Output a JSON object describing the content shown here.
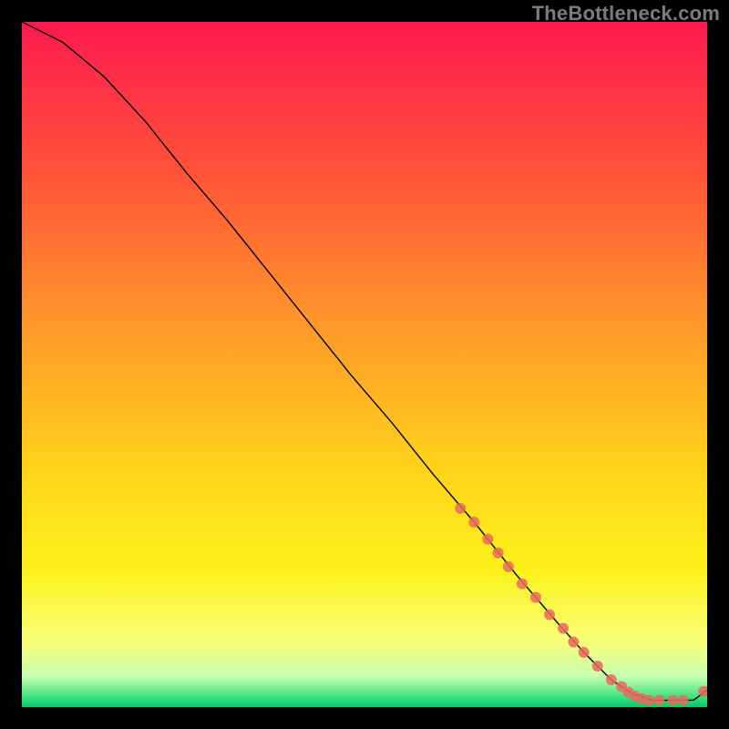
{
  "watermark": "TheBottleneck.com",
  "chart_data": {
    "type": "line",
    "title": "",
    "xlabel": "",
    "ylabel": "",
    "xlim": [
      0,
      100
    ],
    "ylim": [
      0,
      100
    ],
    "grid": false,
    "legend": false,
    "gradient_stops": [
      {
        "pos": 0.0,
        "color": "#ff1a4f"
      },
      {
        "pos": 0.2,
        "color": "#ff4d3a"
      },
      {
        "pos": 0.45,
        "color": "#ff9a2a"
      },
      {
        "pos": 0.65,
        "color": "#ffd21a"
      },
      {
        "pos": 0.8,
        "color": "#fdf11a"
      },
      {
        "pos": 0.905,
        "color": "#f7ff7a"
      },
      {
        "pos": 0.955,
        "color": "#c8ffb0"
      },
      {
        "pos": 0.985,
        "color": "#40e080"
      },
      {
        "pos": 1.0,
        "color": "#00c868"
      }
    ],
    "series": [
      {
        "name": "bottleneck-curve",
        "color": "#000000",
        "width": 1.4,
        "x": [
          0,
          6,
          12,
          18,
          24,
          30,
          36,
          42,
          48,
          54,
          60,
          66,
          72,
          78,
          82,
          86,
          89,
          92,
          95,
          98,
          100
        ],
        "y": [
          100,
          97,
          92,
          85.5,
          78,
          71,
          63.5,
          56,
          48.5,
          41.5,
          34,
          27,
          19.5,
          12.5,
          8,
          4,
          2,
          1,
          1,
          1,
          2.5
        ]
      }
    ],
    "markers": {
      "name": "highlight-points",
      "color": "#e86a5d",
      "radius": 6,
      "x": [
        64,
        66,
        68,
        69.5,
        71,
        73,
        75,
        77,
        79,
        80.5,
        82,
        84,
        86,
        87.5,
        88.5,
        89.5,
        90.5,
        91.5,
        93,
        95,
        96.5,
        99.5
      ],
      "y": [
        29,
        27,
        24.5,
        22.5,
        20.5,
        18,
        16,
        13.5,
        11.5,
        9.5,
        8,
        6,
        4,
        3,
        2.2,
        1.6,
        1.2,
        1,
        1,
        1,
        1,
        2.3
      ]
    }
  }
}
